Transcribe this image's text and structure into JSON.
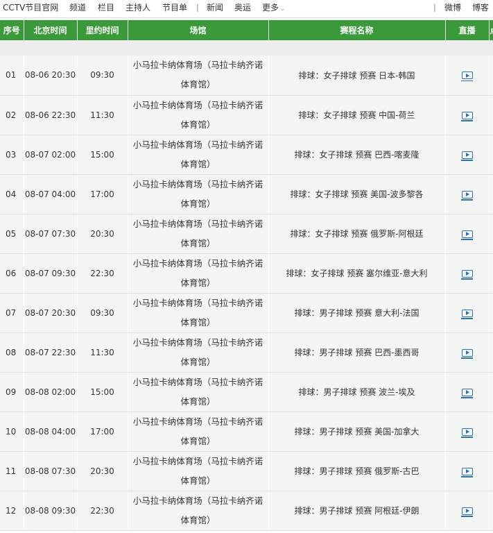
{
  "nav": {
    "site": "CCTV节目官网",
    "items": [
      "频道",
      "栏目",
      "主持人",
      "节目单"
    ],
    "sep": "|",
    "news": "新闻",
    "olympics": "奥运",
    "more": "更多",
    "right": [
      "微博",
      "博客"
    ]
  },
  "table": {
    "headers": [
      "序号",
      "北京时间",
      "里约时间",
      "场馆",
      "赛程名称",
      "直播",
      "点"
    ],
    "rows": [
      {
        "no": "01",
        "bj": "08-06 20:30",
        "rio": "09:30",
        "venue": "小马拉卡纳体育场（马拉卡纳齐诺体育馆）",
        "event": "排球：女子排球 预赛 日本-韩国"
      },
      {
        "no": "02",
        "bj": "08-06 22:30",
        "rio": "11:30",
        "venue": "小马拉卡纳体育场（马拉卡纳齐诺体育馆）",
        "event": "排球：女子排球 预赛 中国-荷兰"
      },
      {
        "no": "03",
        "bj": "08-07 02:00",
        "rio": "15:00",
        "venue": "小马拉卡纳体育场（马拉卡纳齐诺体育馆）",
        "event": "排球：女子排球 预赛 巴西-喀麦隆"
      },
      {
        "no": "04",
        "bj": "08-07 04:00",
        "rio": "17:00",
        "venue": "小马拉卡纳体育场（马拉卡纳齐诺体育馆）",
        "event": "排球：女子排球 预赛 美国-波多黎各"
      },
      {
        "no": "05",
        "bj": "08-07 07:30",
        "rio": "20:30",
        "venue": "小马拉卡纳体育场（马拉卡纳齐诺体育馆）",
        "event": "排球：女子排球 预赛 俄罗斯-阿根廷"
      },
      {
        "no": "06",
        "bj": "08-07 09:30",
        "rio": "22:30",
        "venue": "小马拉卡纳体育场（马拉卡纳齐诺体育馆）",
        "event": "排球：女子排球 预赛 塞尔维亚-意大利"
      },
      {
        "no": "07",
        "bj": "08-07 20:30",
        "rio": "09:30",
        "venue": "小马拉卡纳体育场（马拉卡纳齐诺体育馆）",
        "event": "排球：男子排球 预赛 意大利-法国"
      },
      {
        "no": "08",
        "bj": "08-07 22:30",
        "rio": "11:30",
        "venue": "小马拉卡纳体育场（马拉卡纳齐诺体育馆）",
        "event": "排球：男子排球 预赛 巴西-墨西哥"
      },
      {
        "no": "09",
        "bj": "08-08 02:00",
        "rio": "15:00",
        "venue": "小马拉卡纳体育场（马拉卡纳齐诺体育馆）",
        "event": "排球：男子排球 预赛 波兰-埃及"
      },
      {
        "no": "10",
        "bj": "08-08 04:00",
        "rio": "17:00",
        "venue": "小马拉卡纳体育场（马拉卡纳齐诺体育馆）",
        "event": "排球：男子排球 预赛 美国-加拿大"
      },
      {
        "no": "11",
        "bj": "08-08 07:30",
        "rio": "20:30",
        "venue": "小马拉卡纳体育场（马拉卡纳齐诺体育馆）",
        "event": "排球：男子排球 预赛 俄罗斯-古巴"
      },
      {
        "no": "12",
        "bj": "08-08 09:30",
        "rio": "22:30",
        "venue": "小马拉卡纳体育场（马拉卡纳齐诺体育馆）",
        "event": "排球：男子排球 预赛 阿根廷-伊朗"
      }
    ]
  },
  "icons": {
    "live": "tv-play-icon",
    "more": "chevron-down-icon"
  },
  "colors": {
    "header_bg": "#3a9a3a",
    "row_bg": "#f4f6f4",
    "icon": "#2a6fb8"
  }
}
